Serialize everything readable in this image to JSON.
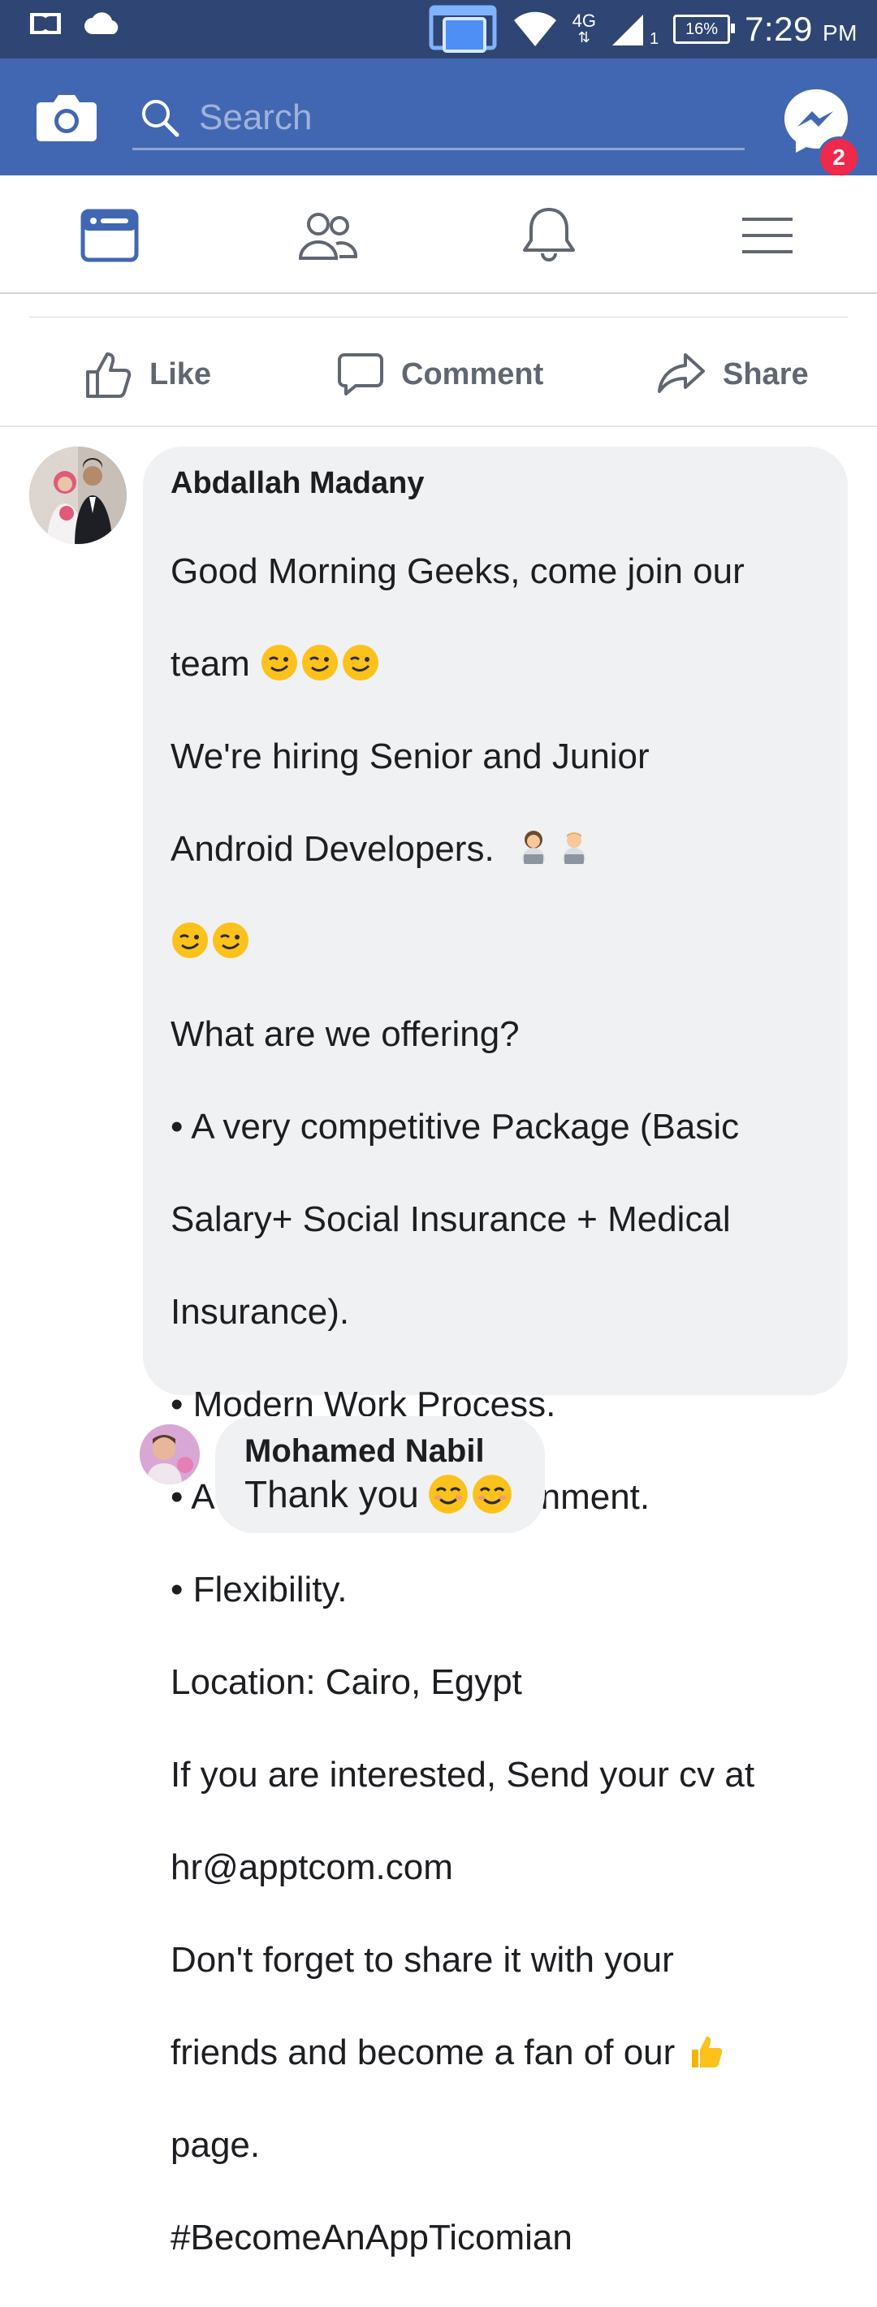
{
  "status_bar": {
    "time": "7:29",
    "ampm": "PM",
    "battery": "16%",
    "network": "4G",
    "signal_sub": "1",
    "left_icons": [
      "dolby-icon",
      "cloud-icon"
    ],
    "right_icons": [
      "screen-mirror-icon",
      "wifi-icon",
      "signal-icon",
      "battery-icon"
    ]
  },
  "app_bar": {
    "search_placeholder": "Search",
    "messenger_badge": "2",
    "accent_color": "#4267b2"
  },
  "tabs": [
    {
      "icon": "news-feed-icon",
      "active": true
    },
    {
      "icon": "friends-icon",
      "active": false
    },
    {
      "icon": "notifications-bell-icon",
      "active": false
    },
    {
      "icon": "menu-icon",
      "active": false
    }
  ],
  "actions": {
    "like": "Like",
    "comment": "Comment",
    "share": "Share"
  },
  "comments": [
    {
      "author": "Abdallah Madany",
      "lines": {
        "l1": "Good Morning Geeks, come join our",
        "l2": "team",
        "l3": "We're hiring Senior and Junior",
        "l4": "Android Developers.",
        "l5": "What are we offering?",
        "l6": "• A very competitive Package (Basic",
        "l7": "Salary+ Social Insurance + Medical",
        "l8": "Insurance).",
        "l9": "• Modern Work Process.",
        "l10": "• A very dynamic environment.",
        "l11": "• Flexibility.",
        "l12": "Location: Cairo, Egypt",
        "l13": "If you are interested, Send your cv at",
        "l14": "hr@apptcom.com",
        "l15": "Don't forget to share it with your",
        "l16": "friends and become a fan of our",
        "l17": "page.",
        "l18": "#BecomeAnAppTicomian"
      },
      "emojis": [
        "winking-face-emoji",
        "woman-technologist-emoji",
        "man-technologist-emoji",
        "thumbs-up-emoji"
      ]
    },
    {
      "author": "Mohamed Nabil",
      "text": "Thank you",
      "emojis": [
        "smiling-face-emoji"
      ]
    }
  ]
}
